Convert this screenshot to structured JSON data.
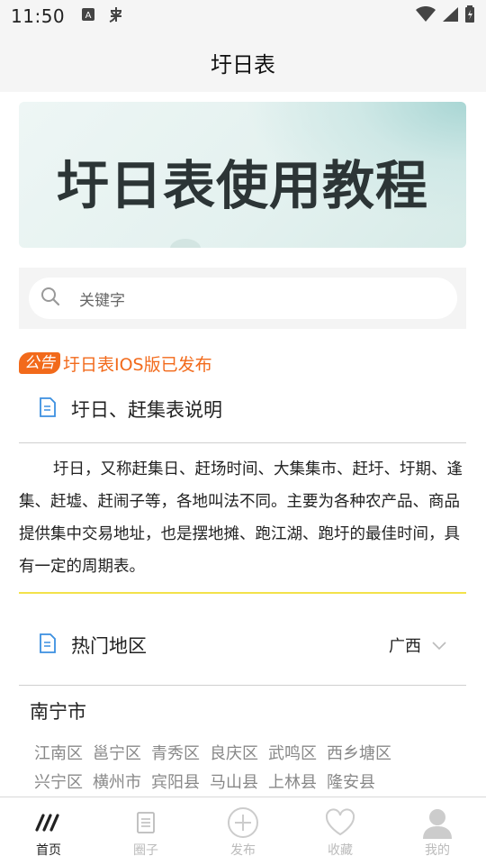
{
  "status_bar": {
    "time": "11:50",
    "left_icons": [
      "font-a-icon",
      "bug-icon"
    ],
    "right_icons": [
      "wifi-icon",
      "signal-icon",
      "battery-icon"
    ]
  },
  "header": {
    "title": "圩日表"
  },
  "banner": {
    "text": "圩日表使用教程"
  },
  "search": {
    "placeholder": "关键字"
  },
  "notice": {
    "tag": "公告",
    "text": "圩日表IOS版已发布"
  },
  "intro": {
    "title": "圩日、赶集表说明",
    "body": "圩日，又称赶集日、赶场时间、大集集市、赶圩、圩期、逢集、赶墟、赶闹子等，各地叫法不同。主要为各种农产品、商品提供集中交易地址，也是摆地摊、跑江湖、跑圩的最佳时间，具有一定的周期表。"
  },
  "hot_regions": {
    "title": "热门地区",
    "province": "广西"
  },
  "city": {
    "name": "南宁市",
    "districts_row1": [
      "江南区",
      "邕宁区",
      "青秀区",
      "良庆区",
      "武鸣区",
      "西乡塘区"
    ],
    "districts_row2": [
      "兴宁区",
      "横州市",
      "宾阳县",
      "马山县",
      "上林县",
      "隆安县"
    ]
  },
  "tabs": [
    {
      "label": "首页",
      "icon": "home-slash-icon",
      "active": true
    },
    {
      "label": "圈子",
      "icon": "document-icon",
      "active": false
    },
    {
      "label": "发布",
      "icon": "plus-circle-icon",
      "active": false
    },
    {
      "label": "收藏",
      "icon": "heart-icon",
      "active": false
    },
    {
      "label": "我的",
      "icon": "user-icon",
      "active": false
    }
  ],
  "colors": {
    "accent": "#f26a1b",
    "doc_icon": "#3b8fe0",
    "yellow_divider": "#f3e24a"
  }
}
